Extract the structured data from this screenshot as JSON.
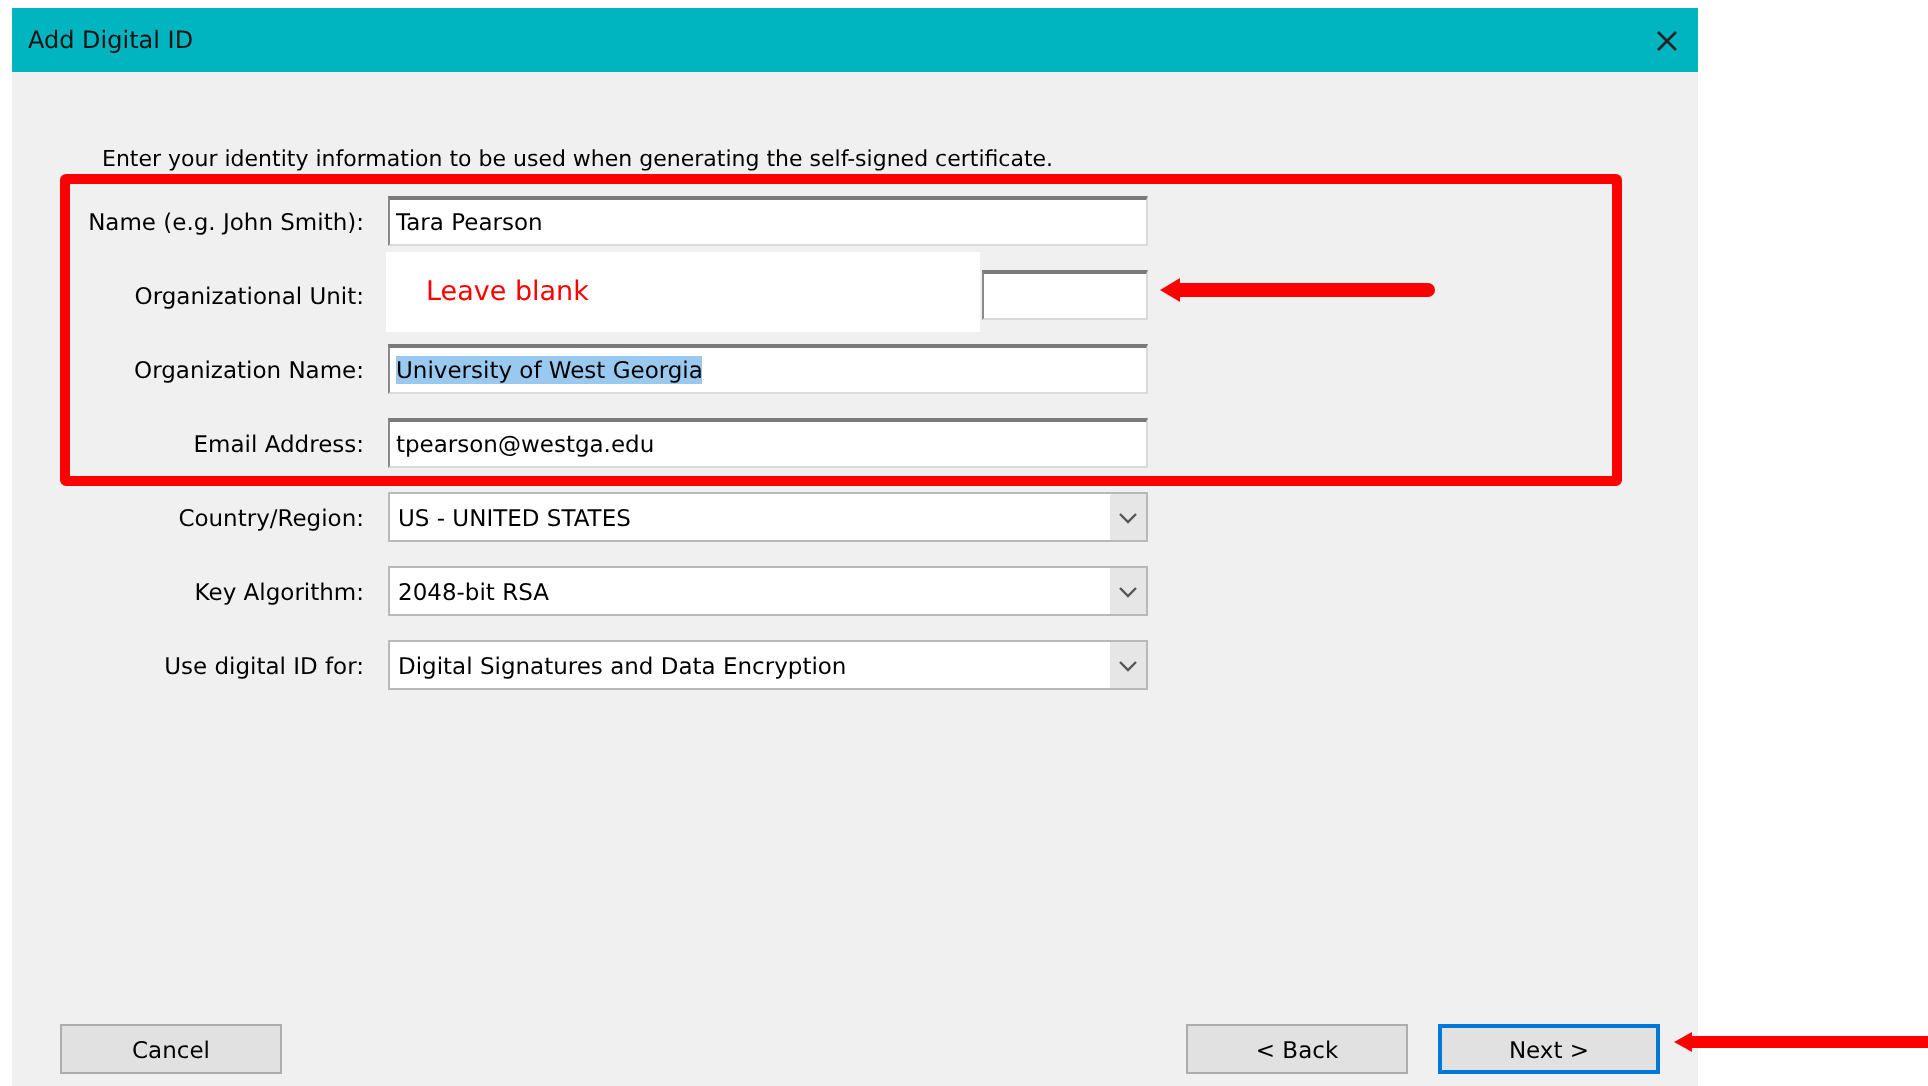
{
  "window": {
    "title": "Add Digital ID"
  },
  "intro": "Enter your identity information to be used when generating the self-signed certificate.",
  "fields": [
    {
      "kind": "text",
      "label": "Name (e.g. John Smith):",
      "value": "Tara Pearson",
      "text_selected": false,
      "partly_hidden": false
    },
    {
      "kind": "text",
      "label": "Organizational Unit:",
      "partly_hidden": true
    },
    {
      "kind": "text",
      "label": "Organization Name:",
      "value": "University of West Georgia",
      "text_selected": true,
      "partly_hidden": false
    },
    {
      "kind": "text",
      "label": "Email Address:",
      "value": "tpearson@westga.edu",
      "text_selected": false,
      "partly_hidden": false
    },
    {
      "kind": "dropdown",
      "label": "Country/Region:",
      "value": "US - UNITED STATES"
    },
    {
      "kind": "dropdown",
      "label": "Key Algorithm:",
      "value": "2048-bit RSA"
    },
    {
      "kind": "dropdown",
      "label": "Use digital ID for:",
      "value": "Digital Signatures and Data Encryption"
    }
  ],
  "buttons": [
    {
      "label": "Cancel",
      "default": false
    },
    {
      "label": "< Back",
      "default": false
    },
    {
      "label": "Next >",
      "default": true
    }
  ],
  "annotation": {
    "text": "Leave blank"
  }
}
